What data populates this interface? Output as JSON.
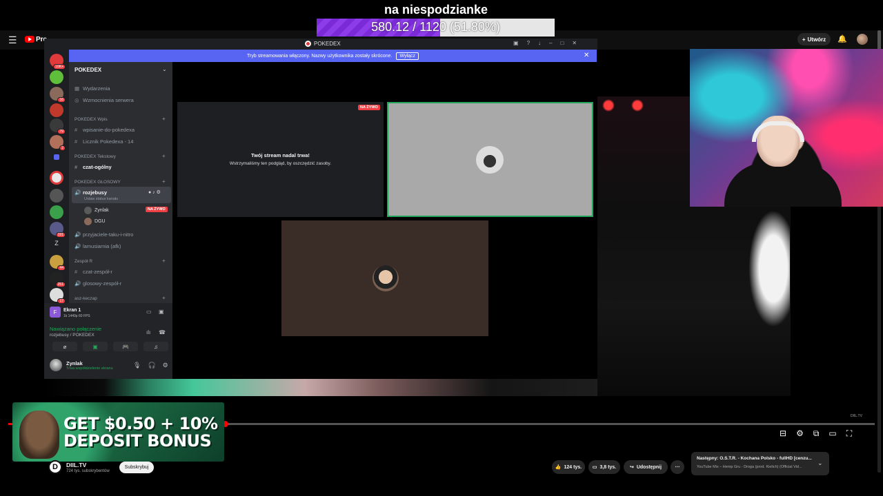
{
  "overlay": {
    "goal_title": "na niespodzianke",
    "goal_progress_text": "580.12 / 1120 (51.80%)",
    "goal_fraction": 0.518
  },
  "youtube": {
    "logo_text": "Pre",
    "create_label": "Utwórz",
    "channel_name": "DIIL.TV",
    "channel_subs": "724 tys. subskrybentów",
    "subscribe_label": "Subskrybuj",
    "likes": "124 tys.",
    "comments": "3,8 tys.",
    "share_label": "Udostępnij",
    "more_label": "⋯",
    "next_title": "Następny: O.S.T.R. - Kochana Polsko - fullHD [cenzu...",
    "next_subtitle": "YouTube Mix – Hemp Gru - Droga (prod. Kielich) (Official Vid...",
    "watermark": "DIIL.TV",
    "progress_fraction": 0.25
  },
  "discord": {
    "window_title": "POKEDEX",
    "banner_text": "Tryb streamowania włączony. Nazwy użytkownika zostały skrócone.",
    "banner_button": "Wyłącz",
    "server_name": "POKEDEX",
    "top_items": [
      "Wydarzenia",
      "Wzmocnienia serwera"
    ],
    "cat1": "POKEDEX Wpis",
    "cat1_channels": [
      "wpisanie-do-pokedexa",
      "Licznik Pokedexa - 14"
    ],
    "cat2": "POKEDEX Tekstowy",
    "cat2_channels": [
      "czat-ogólny"
    ],
    "cat3": "POKEDEX GŁOSOWY",
    "voice_channel": "rozjebusy",
    "voice_status": "Ustaw status kanału",
    "voice_users": [
      "Zynlak",
      "DGU"
    ],
    "live_badge": "NA ŻYWO",
    "other_voice": [
      "przyjaciele-taku-i-nitro",
      "lamusiarnia (afk)"
    ],
    "cat4": "Zespół R",
    "cat4_channels": [
      "czat-zespół-r",
      "glosowy-zespół-r"
    ],
    "cat5": "asz-keczap",
    "screen_label": "Ekran 1",
    "screen_sub": "1k 1440p 60 FPS",
    "conn_status": "Nawiązano połączenie",
    "conn_channel": "rozjebusy / POKEDEX",
    "user_name": "Zynlak",
    "user_status": "Trwa współdzielenie ekranu",
    "stream_title": "Twój stream nadal trwa!",
    "stream_sub": "Wstrzymaliśmy ten podgląd, by oszczędzić zasoby.",
    "guild_badges": [
      "16K+",
      "16",
      "79",
      "2",
      "191",
      "44",
      "251",
      "17"
    ]
  },
  "ad": {
    "line1": "GET $0.50 + 10%",
    "line2": "DEPOSIT BONUS"
  },
  "colors": {
    "goal_fill": "#7a2ad6",
    "discord_blurple": "#5865f2",
    "live_red": "#f23f43",
    "connected_green": "#23a559"
  }
}
